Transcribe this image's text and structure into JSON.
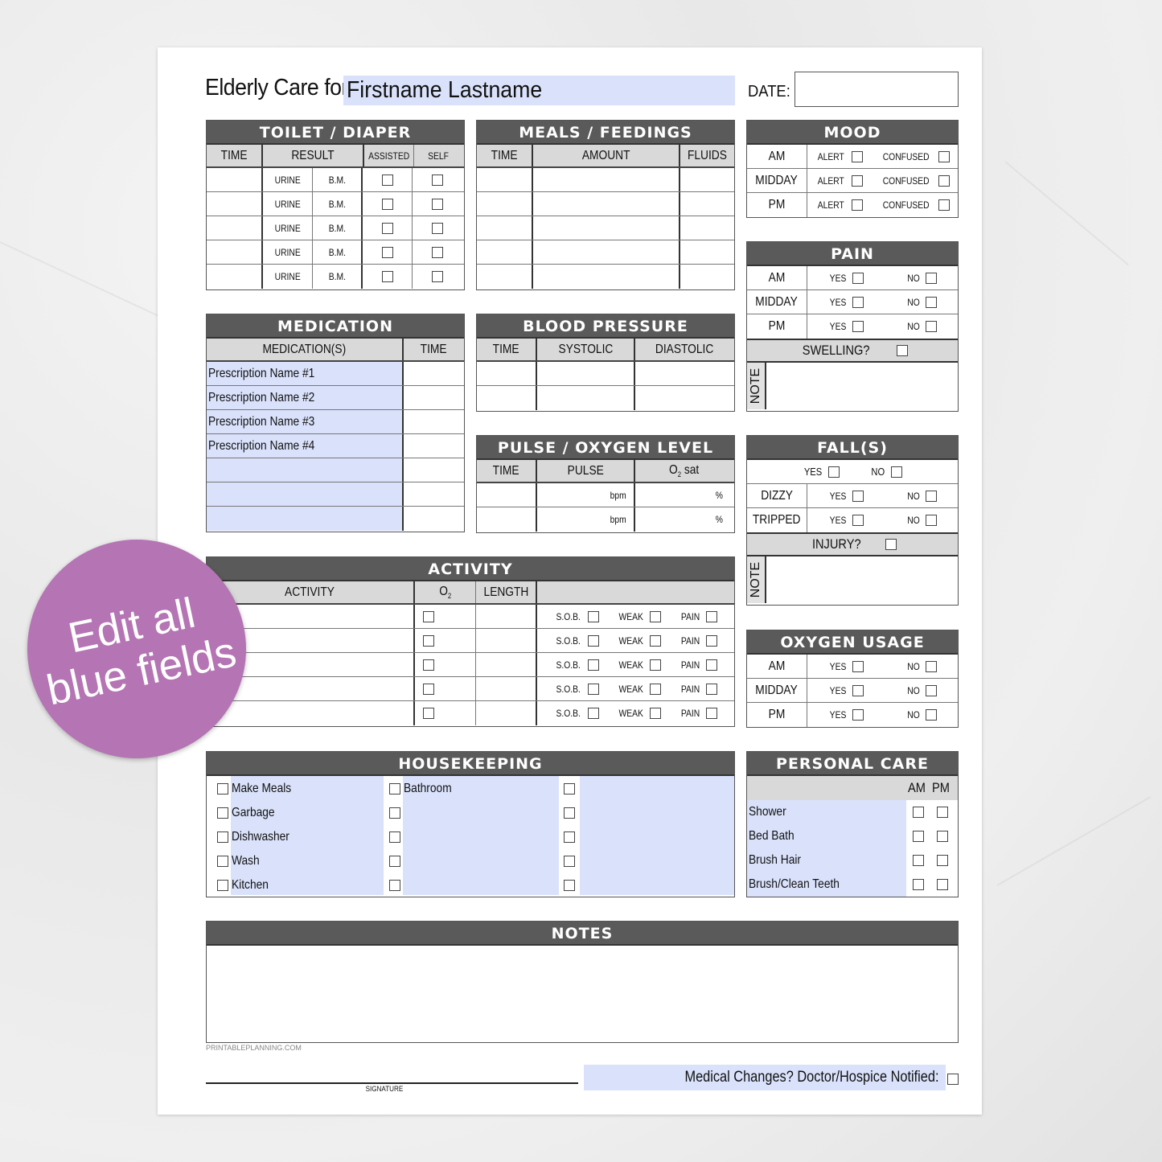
{
  "header": {
    "title_prefix": "Elderly Care for",
    "name_field": "Firstname Lastname",
    "date_label": "DATE:",
    "date_value": ""
  },
  "toilet": {
    "title": "TOILET / DIAPER",
    "columns": [
      "TIME",
      "RESULT",
      "ASSISTED",
      "SELF"
    ],
    "rows": [
      {
        "time": "",
        "urine": "URINE",
        "bm": "B.M."
      },
      {
        "time": "",
        "urine": "URINE",
        "bm": "B.M."
      },
      {
        "time": "",
        "urine": "URINE",
        "bm": "B.M."
      },
      {
        "time": "",
        "urine": "URINE",
        "bm": "B.M."
      },
      {
        "time": "",
        "urine": "URINE",
        "bm": "B.M."
      }
    ]
  },
  "meals": {
    "title": "MEALS / FEEDINGS",
    "columns": [
      "TIME",
      "AMOUNT",
      "FLUIDS"
    ]
  },
  "mood": {
    "title": "MOOD",
    "option1": "ALERT",
    "option2": "CONFUSED",
    "rows": [
      "AM",
      "MIDDAY",
      "PM"
    ]
  },
  "pain": {
    "title": "PAIN",
    "yes": "YES",
    "no": "NO",
    "rows": [
      "AM",
      "MIDDAY",
      "PM"
    ],
    "swelling": "SWELLING?",
    "note": "NOTE"
  },
  "medication": {
    "title": "MEDICATION",
    "columns": [
      "MEDICATION(S)",
      "TIME"
    ],
    "rows": [
      "Prescription Name #1",
      "Prescription Name #2",
      "Prescription Name #3",
      "Prescription Name #4",
      "",
      "",
      ""
    ]
  },
  "blood_pressure": {
    "title": "BLOOD PRESSURE",
    "columns": [
      "TIME",
      "SYSTOLIC",
      "DIASTOLIC"
    ]
  },
  "pulse": {
    "title": "PULSE / OXYGEN LEVEL",
    "columns": [
      "TIME",
      "PULSE",
      "O",
      "2",
      "sat"
    ],
    "unit_pulse": "bpm",
    "unit_o2": "%"
  },
  "falls": {
    "title": "FALL(S)",
    "yes": "YES",
    "no": "NO",
    "rows": [
      "DIZZY",
      "TRIPPED"
    ],
    "injury": "INJURY?",
    "note": "NOTE"
  },
  "activity": {
    "title": "ACTIVITY",
    "columns": [
      "ACTIVITY",
      "O",
      "2",
      "LENGTH"
    ],
    "sob": "S.O.B.",
    "weak": "WEAK",
    "pain": "PAIN"
  },
  "oxygen": {
    "title": "OXYGEN USAGE",
    "yes": "YES",
    "no": "NO",
    "rows": [
      "AM",
      "MIDDAY",
      "PM"
    ]
  },
  "housekeeping": {
    "title": "HOUSEKEEPING",
    "col1": [
      "Make Meals",
      "Garbage",
      "Dishwasher",
      "Wash",
      "Kitchen"
    ],
    "col2": [
      "Bathroom",
      "",
      "",
      "",
      ""
    ],
    "col3": [
      "",
      "",
      "",
      "",
      ""
    ]
  },
  "personal_care": {
    "title": "PERSONAL CARE",
    "am": "AM",
    "pm": "PM",
    "rows": [
      "Shower",
      "Bed Bath",
      "Brush Hair",
      "Brush/Clean Teeth"
    ]
  },
  "notes": {
    "title": "NOTES",
    "value": ""
  },
  "footer": {
    "site": "PRINTABLEPLANNING.COM",
    "signature_label": "SIGNATURE",
    "medical_changes": "Medical Changes?  Doctor/Hospice Notified:"
  },
  "badge": {
    "line1": "Edit all",
    "line2": "blue fields"
  },
  "colors": {
    "header_bg": "#5a5a5a",
    "subheader_bg": "#d9d9d9",
    "editable_blue": "#dae2fb",
    "badge_purple": "#b574b4"
  }
}
